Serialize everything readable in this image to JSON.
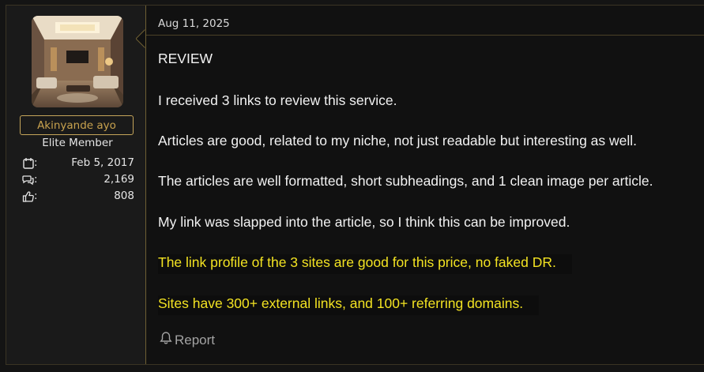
{
  "post": {
    "date": "Aug 11, 2025",
    "lines": [
      "REVIEW",
      "I received 3 links to review this service.",
      "Articles are good, related to my niche, not just readable but interesting as well.",
      "The articles are well formatted, short subheadings, and 1 clean image per article.",
      "My link was slapped into the article, so I think this can be improved.",
      "The link profile of the 3 sites are good for this price, no faked DR.",
      "Sites have 300+ external links, and 100+ referring domains."
    ],
    "report_label": "Report"
  },
  "user": {
    "name": "Akinyande ayo",
    "title": "Elite Member",
    "stats": {
      "joined": "Feb 5, 2017",
      "messages": "2,169",
      "reactions": "808"
    }
  },
  "colors": {
    "accent_gold": "#c8a24e",
    "highlight_yellow": "#f3e322",
    "background": "#111111"
  },
  "icons": {
    "joined": "calendar-icon",
    "messages": "speech-bubbles-icon",
    "reactions": "thumbs-up-icon",
    "report": "bell-icon"
  }
}
